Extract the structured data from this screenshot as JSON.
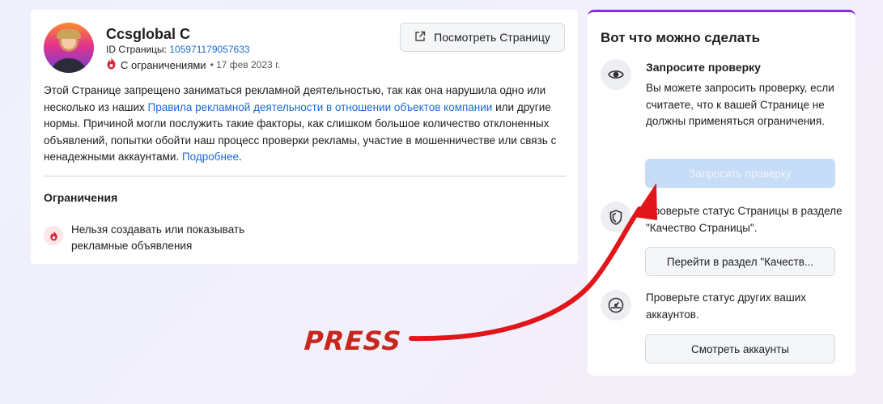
{
  "left": {
    "page_name": "Ccsglobal C",
    "id_label": "ID Страницы:",
    "id_value": "105971179057633",
    "status_label": "С ограничениями",
    "date_text": "• 17 фев 2023 г.",
    "view_button": "Посмотреть Страницу",
    "body": {
      "part1": "Этой Странице запрещено заниматься рекламной деятельностью, так как она нарушила одно или несколько из наших ",
      "link1": "Правила рекламной деятельности в отношении объектов компании",
      "part2": " или другие нормы. Причиной могли послужить такие факторы, как слишком большое количество отклоненных объявлений, попытки обойти наш процесс проверки рекламы, участие в мошенничестве или связь с ненадежными аккаунтами. ",
      "link2": "Подробнее",
      "part3": "."
    },
    "restrictions_title": "Ограничения",
    "restriction_item": "Нельзя создавать или показывать рекламные объявления"
  },
  "right": {
    "title": "Вот что можно сделать",
    "review": {
      "heading": "Запросите проверку",
      "text": "Вы можете запросить проверку, если считаете, что к вашей Странице не должны применяться ограничения.",
      "button": "Запросить проверку"
    },
    "quality": {
      "text": "Проверьте статус Страницы в разделе \"Качество Страницы\".",
      "button": "Перейти в раздел \"Качеств..."
    },
    "accounts": {
      "text": "Проверьте статус других ваших аккаунтов.",
      "button": "Смотреть аккаунты"
    }
  },
  "annotation": {
    "label": "PRESS",
    "color": "#e0161b"
  },
  "colors": {
    "link": "#1a6ad6",
    "accent_border": "#8a2be2",
    "disabled_button": "#c7dcf6"
  },
  "icons": [
    "external-link-icon",
    "restriction-icon",
    "eye-icon",
    "shield-icon",
    "speedometer-icon"
  ]
}
